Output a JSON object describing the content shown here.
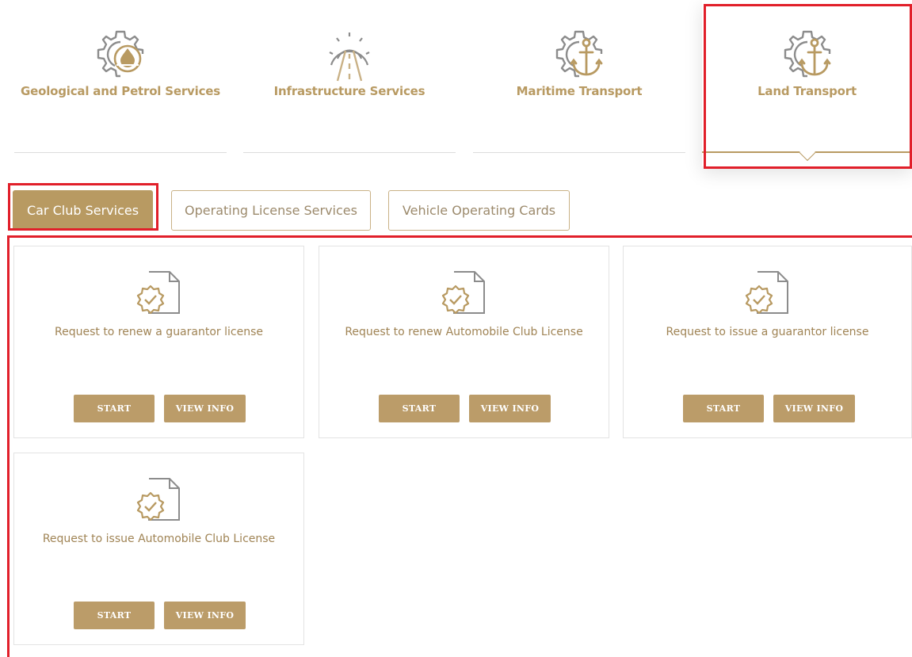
{
  "categories": [
    {
      "label": "Geological and Petrol Services",
      "icon": "gear-oil-icon"
    },
    {
      "label": "Infrastructure Services",
      "icon": "gear-road-icon"
    },
    {
      "label": "Maritime Transport",
      "icon": "gear-anchor-icon"
    },
    {
      "label": "Land Transport",
      "icon": "gear-anchor-icon"
    }
  ],
  "tabs": [
    {
      "label": "Car Club Services"
    },
    {
      "label": "Operating License Services"
    },
    {
      "label": "Vehicle Operating Cards"
    }
  ],
  "cards": [
    {
      "title": "Request to renew a guarantor license",
      "start": "START",
      "info": "VIEW INFO"
    },
    {
      "title": "Request to renew Automobile Club License",
      "start": "START",
      "info": "VIEW INFO"
    },
    {
      "title": "Request to issue a guarantor license",
      "start": "START",
      "info": "VIEW INFO"
    },
    {
      "title": "Request to issue Automobile Club License",
      "start": "START",
      "info": "VIEW INFO"
    }
  ],
  "colors": {
    "accent": "#b89a62",
    "highlight": "#e11f2a",
    "icon_gray": "#8c8c8c"
  }
}
